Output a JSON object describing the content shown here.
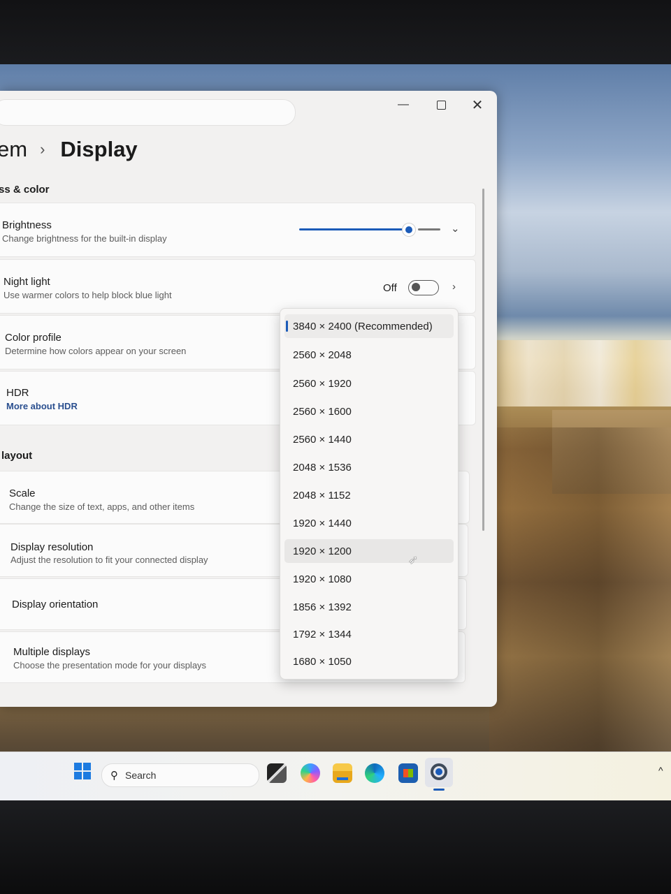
{
  "window": {
    "breadcrumb_parent": "em",
    "breadcrumb_sep": "›",
    "breadcrumb_current": "Display",
    "controls": {
      "minimize": "—",
      "close": "✕"
    }
  },
  "sections": {
    "brightness_color": "ss & color",
    "layout": "layout"
  },
  "brightness": {
    "title": "Brightness",
    "subtitle": "Change brightness for the built-in display",
    "level": 0.77
  },
  "night_light": {
    "title": "Night light",
    "subtitle": "Use warmer colors to help block blue light",
    "state": "Off"
  },
  "color_profile": {
    "title": "Color profile",
    "subtitle": "Determine how colors appear on your screen"
  },
  "hdr": {
    "title": "HDR",
    "link": "More about HDR"
  },
  "scale": {
    "title": "Scale",
    "subtitle": "Change the size of text, apps, and other items"
  },
  "display_resolution": {
    "title": "Display resolution",
    "subtitle": "Adjust the resolution to fit your connected display"
  },
  "display_orientation": {
    "title": "Display orientation"
  },
  "multiple_displays": {
    "title": "Multiple displays",
    "subtitle": "Choose the presentation mode for your displays"
  },
  "resolution_dropdown": {
    "selected_index": 0,
    "hover_index": 8,
    "options": [
      "3840 × 2400 (Recommended)",
      "2560 × 2048",
      "2560 × 1920",
      "2560 × 1600",
      "2560 × 1440",
      "2048 × 1536",
      "2048 × 1152",
      "1920 × 1440",
      "1920 × 1200",
      "1920 × 1080",
      "1856 × 1392",
      "1792 × 1344",
      "1680 × 1050"
    ]
  },
  "taskbar": {
    "search_label": "Search",
    "search_icon": "⚲",
    "tray_chevron": "^",
    "icons": [
      "windows-start-icon",
      "task-view-icon",
      "copilot-icon",
      "file-explorer-icon",
      "edge-icon",
      "store-icon",
      "settings-icon"
    ]
  },
  "accent_color": "#1b5bb8"
}
